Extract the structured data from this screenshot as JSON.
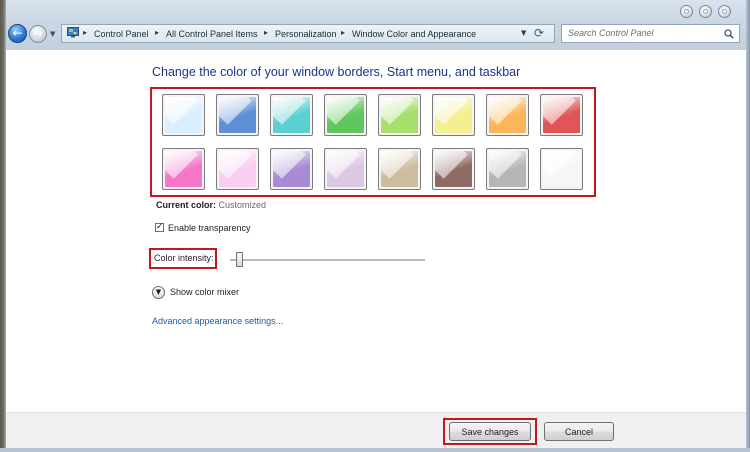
{
  "window": {
    "controls": [
      "minimize",
      "maximize",
      "close"
    ]
  },
  "navigation": {
    "back_icon": "arrow-left-icon",
    "forward_icon": "arrow-right-icon",
    "history_icon": "chevron-down-icon"
  },
  "address_bar": {
    "location_icon": "control-panel-icon",
    "breadcrumbs": [
      "Control Panel",
      "All Control Panel Items",
      "Personalization",
      "Window Color and Appearance"
    ],
    "separator": "▸",
    "dropdown_icon": "chevron-down-icon",
    "refresh_icon": "refresh-icon"
  },
  "search": {
    "placeholder": "Search Control Panel",
    "icon": "search-icon"
  },
  "main": {
    "heading": "Change the color of your window borders, Start menu, and taskbar",
    "swatches": [
      {
        "name": "sky",
        "color": "#dbeeff"
      },
      {
        "name": "twilight",
        "color": "#5f8fd6"
      },
      {
        "name": "sea",
        "color": "#5cd0d0"
      },
      {
        "name": "leaf",
        "color": "#5fc75d"
      },
      {
        "name": "lime",
        "color": "#a6df6a"
      },
      {
        "name": "lemon",
        "color": "#f4ef8f"
      },
      {
        "name": "pumpkin",
        "color": "#fbb65c"
      },
      {
        "name": "ruby",
        "color": "#e05555"
      },
      {
        "name": "fuchsia",
        "color": "#f577c8"
      },
      {
        "name": "blush",
        "color": "#f9cdf0"
      },
      {
        "name": "violet",
        "color": "#a98ad4"
      },
      {
        "name": "lavender",
        "color": "#dcc8e3"
      },
      {
        "name": "taupe",
        "color": "#cdbd9f"
      },
      {
        "name": "chocolate",
        "color": "#8d6a64"
      },
      {
        "name": "slate",
        "color": "#b5b5b5"
      },
      {
        "name": "frost",
        "color": "#f6f6f6"
      }
    ],
    "current_color_label": "Current color:",
    "current_color_value": "Customized",
    "enable_transparency_label": "Enable transparency",
    "enable_transparency_checked": true,
    "color_intensity_label": "Color intensity:",
    "color_intensity_level": 0.03,
    "show_color_mixer_label": "Show color mixer",
    "advanced_link": "Advanced appearance settings..."
  },
  "footer": {
    "save_label": "Save changes",
    "cancel_label": "Cancel"
  },
  "colors": {
    "highlight": "#c4161c",
    "heading": "#1e3287",
    "link": "#1e5a9e"
  }
}
